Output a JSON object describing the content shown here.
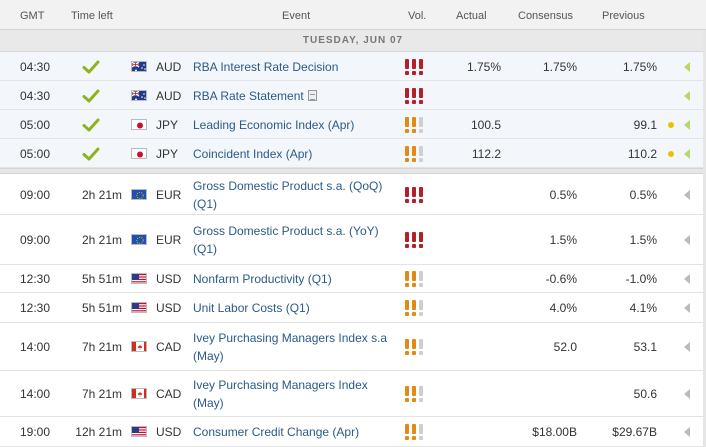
{
  "columns": {
    "gmt": "GMT",
    "time_left": "Time left",
    "event": "Event",
    "vol": "Vol.",
    "actual": "Actual",
    "consensus": "Consensus",
    "previous": "Previous"
  },
  "day_label": "TUESDAY, JUN 07",
  "colors": {
    "event_link": "#2a5a8a",
    "high_volatility": "#b3202a",
    "medium_volatility": "#e48a14",
    "check": "#8ab51b",
    "past_row_bg": "#f3f7fb"
  },
  "rows": [
    {
      "time": "04:30",
      "time_left": "",
      "done": true,
      "currency": "AUD",
      "flag": "australia-flag",
      "event": "RBA Interest Rate Decision",
      "has_doc": false,
      "volatility": "high",
      "actual": "1.75%",
      "consensus": "1.75%",
      "previous": "1.75%",
      "revised": false
    },
    {
      "time": "04:30",
      "time_left": "",
      "done": true,
      "currency": "AUD",
      "flag": "australia-flag",
      "event": "RBA Rate Statement",
      "has_doc": true,
      "volatility": "high",
      "actual": "",
      "consensus": "",
      "previous": "",
      "revised": false
    },
    {
      "time": "05:00",
      "time_left": "",
      "done": true,
      "currency": "JPY",
      "flag": "japan-flag",
      "event": "Leading Economic Index (Apr)",
      "has_doc": false,
      "volatility": "medium",
      "actual": "100.5",
      "consensus": "",
      "previous": "99.1",
      "revised": true
    },
    {
      "time": "05:00",
      "time_left": "",
      "done": true,
      "currency": "JPY",
      "flag": "japan-flag",
      "event": "Coincident Index (Apr)",
      "has_doc": false,
      "volatility": "medium",
      "actual": "112.2",
      "consensus": "",
      "previous": "110.2",
      "revised": true
    },
    {
      "time": "09:00",
      "time_left": "2h 21m",
      "done": false,
      "currency": "EUR",
      "flag": "eu-flag",
      "event": "Gross Domestic Product s.a. (QoQ) (Q1)",
      "has_doc": false,
      "volatility": "high",
      "actual": "",
      "consensus": "0.5%",
      "previous": "0.5%",
      "revised": false
    },
    {
      "time": "09:00",
      "time_left": "2h 21m",
      "done": false,
      "currency": "EUR",
      "flag": "eu-flag",
      "event": "Gross Domestic Product s.a. (YoY) (Q1)",
      "has_doc": false,
      "volatility": "high",
      "actual": "",
      "consensus": "1.5%",
      "previous": "1.5%",
      "revised": false
    },
    {
      "time": "12:30",
      "time_left": "5h 51m",
      "done": false,
      "currency": "USD",
      "flag": "usa-flag",
      "event": "Nonfarm Productivity (Q1)",
      "has_doc": false,
      "volatility": "medium",
      "actual": "",
      "consensus": "-0.6%",
      "previous": "-1.0%",
      "revised": false
    },
    {
      "time": "12:30",
      "time_left": "5h 51m",
      "done": false,
      "currency": "USD",
      "flag": "usa-flag",
      "event": "Unit Labor Costs (Q1)",
      "has_doc": false,
      "volatility": "medium",
      "actual": "",
      "consensus": "4.0%",
      "previous": "4.1%",
      "revised": false
    },
    {
      "time": "14:00",
      "time_left": "7h 21m",
      "done": false,
      "currency": "CAD",
      "flag": "canada-flag",
      "event": "Ivey Purchasing Managers Index s.a (May)",
      "has_doc": false,
      "volatility": "medium",
      "actual": "",
      "consensus": "52.0",
      "previous": "53.1",
      "revised": false
    },
    {
      "time": "14:00",
      "time_left": "7h 21m",
      "done": false,
      "currency": "CAD",
      "flag": "canada-flag",
      "event": "Ivey Purchasing Managers Index (May)",
      "has_doc": false,
      "volatility": "medium",
      "actual": "",
      "consensus": "",
      "previous": "50.6",
      "revised": false
    },
    {
      "time": "19:00",
      "time_left": "12h 21m",
      "done": false,
      "currency": "USD",
      "flag": "usa-flag",
      "event": "Consumer Credit Change (Apr)",
      "has_doc": false,
      "volatility": "medium",
      "actual": "",
      "consensus": "$18.00B",
      "previous": "$29.67B",
      "revised": false
    }
  ]
}
